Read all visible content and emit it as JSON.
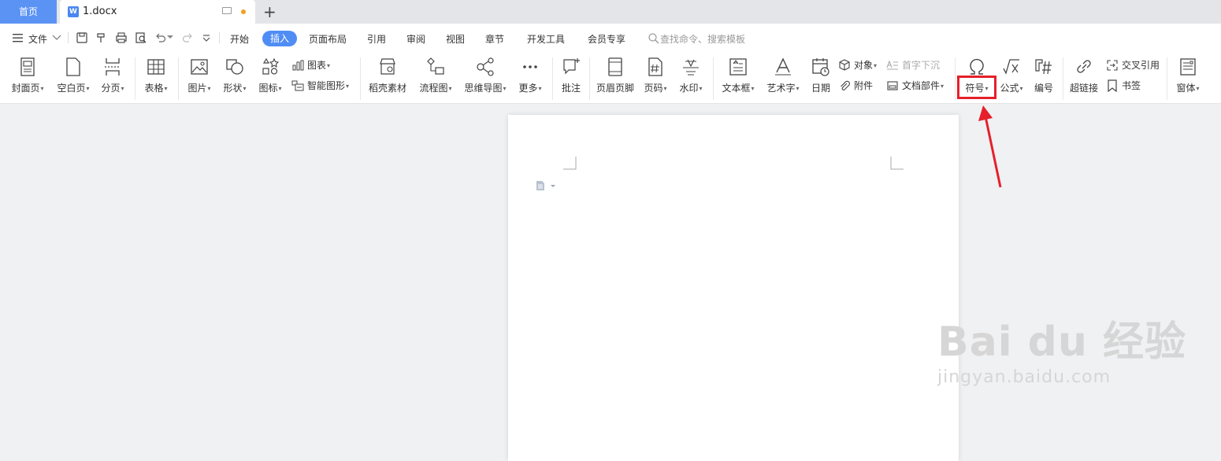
{
  "tabs": {
    "home": "首页",
    "doc": "1.docx",
    "add": "+"
  },
  "menu": {
    "file": "文件",
    "items": [
      "开始",
      "插入",
      "页面布局",
      "引用",
      "审阅",
      "视图",
      "章节",
      "开发工具",
      "会员专享"
    ],
    "active": "插入",
    "search_placeholder": "查找命令、搜索模板"
  },
  "ribbon": {
    "cover": "封面页",
    "blank": "空白页",
    "break": "分页",
    "table": "表格",
    "picture": "图片",
    "shape": "形状",
    "icon": "图标",
    "chart": "图表",
    "smartart": "智能图形",
    "docer": "稻壳素材",
    "flow": "流程图",
    "mindmap": "思维导图",
    "more": "更多",
    "comment": "批注",
    "headerfooter": "页眉页脚",
    "pagenum": "页码",
    "watermark": "水印",
    "textbox": "文本框",
    "wordart": "艺术字",
    "date": "日期",
    "object": "对象",
    "attachment": "附件",
    "dropcap": "首字下沉",
    "docpart": "文档部件",
    "symbol": "符号",
    "formula": "公式",
    "numbering": "编号",
    "hyperlink": "超链接",
    "crossref": "交叉引用",
    "bookmark": "书签",
    "window": "窗体"
  },
  "watermark": {
    "brand": "Bai du 经验",
    "url": "jingyan.baidu.com"
  },
  "colors": {
    "accent": "#4f8df5",
    "highlight": "#e5202a"
  }
}
